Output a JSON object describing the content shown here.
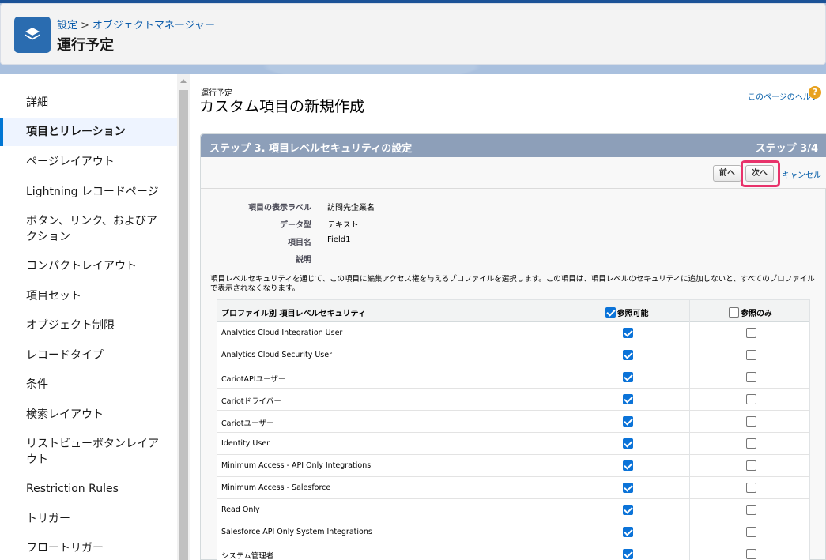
{
  "header": {
    "breadcrumb": [
      "設定",
      "オブジェクトマネージャー"
    ],
    "breadcrumb_sep": ">",
    "title": "運行予定",
    "icon": "layers-icon"
  },
  "sidebar": {
    "items": [
      {
        "label": "詳細",
        "active": false
      },
      {
        "label": "項目とリレーション",
        "active": true
      },
      {
        "label": "ページレイアウト",
        "active": false
      },
      {
        "label": "Lightning レコードページ",
        "active": false
      },
      {
        "label": "ボタン、リンク、およびアクション",
        "active": false
      },
      {
        "label": "コンパクトレイアウト",
        "active": false
      },
      {
        "label": "項目セット",
        "active": false
      },
      {
        "label": "オブジェクト制限",
        "active": false
      },
      {
        "label": "レコードタイプ",
        "active": false
      },
      {
        "label": "条件",
        "active": false
      },
      {
        "label": "検索レイアウト",
        "active": false
      },
      {
        "label": "リストビューボタンレイアウト",
        "active": false
      },
      {
        "label": "Restriction Rules",
        "active": false
      },
      {
        "label": "トリガー",
        "active": false
      },
      {
        "label": "フロートリガー",
        "active": false
      }
    ]
  },
  "content": {
    "subtitle": "運行予定",
    "title": "カスタム項目の新規作成",
    "help_link": "このページのヘルプ",
    "help_icon": "?",
    "step_title": "ステップ 3. 項目レベルセキュリティの設定",
    "step_count": "ステップ 3/4",
    "buttons": {
      "prev": "前へ",
      "next": "次へ",
      "cancel": "キャンセル"
    },
    "details": [
      {
        "label": "項目の表示ラベル",
        "value": "訪問先企業名"
      },
      {
        "label": "データ型",
        "value": "テキスト"
      },
      {
        "label": "項目名",
        "value": "Field1"
      },
      {
        "label": "説明",
        "value": ""
      }
    ],
    "description": "項目レベルセキュリティを通じて、この項目に編集アクセス権を与えるプロファイルを選択します。この項目は、項目レベルのセキュリティに追加しないと、すべてのプロファイルで表示されなくなります。"
  },
  "table": {
    "header_profile": "プロファイル別 項目レベルセキュリティ",
    "header_read": "参照可能",
    "header_readonly": "参照のみ",
    "header_read_checked": true,
    "header_readonly_checked": false,
    "rows": [
      {
        "profile": "Analytics Cloud Integration User",
        "read": true,
        "readonly": false
      },
      {
        "profile": "Analytics Cloud Security User",
        "read": true,
        "readonly": false
      },
      {
        "profile": "CariotAPIユーザー",
        "read": true,
        "readonly": false
      },
      {
        "profile": "Cariotドライバー",
        "read": true,
        "readonly": false
      },
      {
        "profile": "Cariotユーザー",
        "read": true,
        "readonly": false
      },
      {
        "profile": "Identity User",
        "read": true,
        "readonly": false
      },
      {
        "profile": "Minimum Access - API Only Integrations",
        "read": true,
        "readonly": false
      },
      {
        "profile": "Minimum Access - Salesforce",
        "read": true,
        "readonly": false
      },
      {
        "profile": "Read Only",
        "read": true,
        "readonly": false
      },
      {
        "profile": "Salesforce API Only System Integrations",
        "read": true,
        "readonly": false
      },
      {
        "profile": "システム管理者",
        "read": true,
        "readonly": false
      }
    ]
  }
}
